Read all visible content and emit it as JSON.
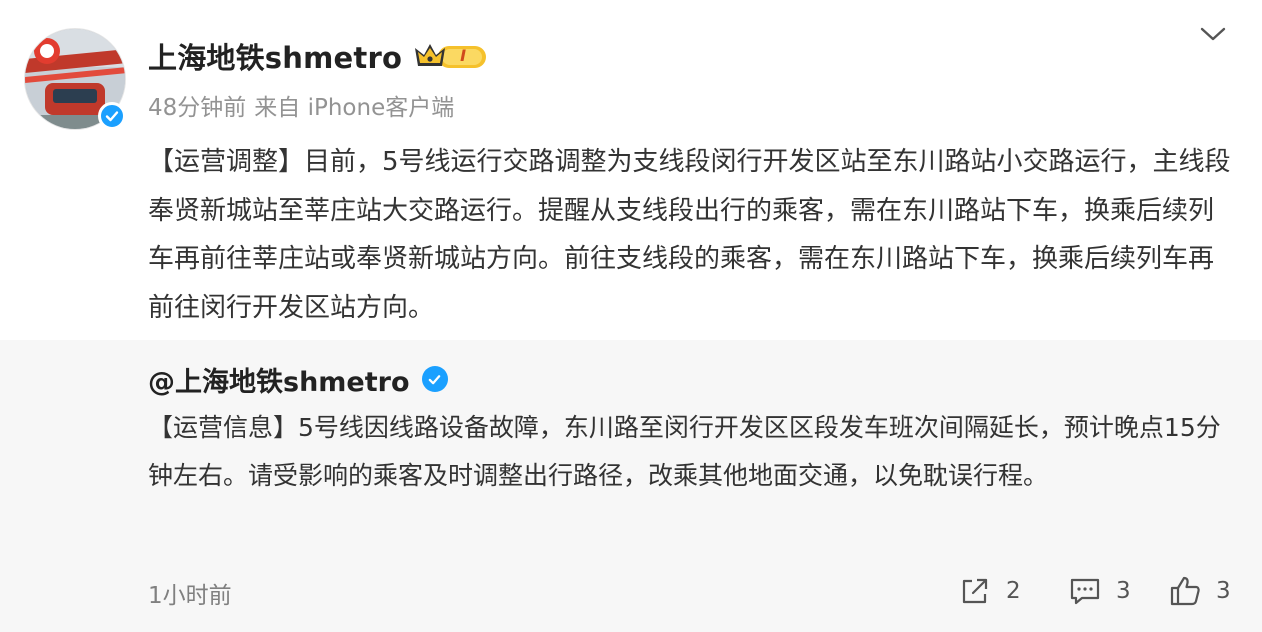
{
  "post": {
    "author_name": "上海地铁shmetro",
    "vip_level": "I",
    "time_ago": "48分钟前",
    "source": "来自 iPhone客户端",
    "content": "【运营调整】目前，5号线运行交路调整为支线段闵行开发区站至东川路站小交路运行，主线段奉贤新城站至莘庄站大交路运行。提醒从支线段出行的乘客，需在东川路站下车，换乘后续列车再前往莘庄站或奉贤新城站方向。前往支线段的乘客，需在东川路站下车，换乘后续列车再前往闵行开发区站方向。"
  },
  "repost": {
    "author_handle": "@上海地铁shmetro",
    "content": "【运营信息】5号线因线路设备故障，东川路至闵行开发区区段发车班次间隔延长，预计晚点15分钟左右。请受影响的乘客及时调整出行路径，改乘其他地面交通，以免耽误行程。",
    "time_ago": "1小时前",
    "share_count": "2",
    "comment_count": "3",
    "like_count": "3"
  },
  "icons": {
    "more": "chevron-down-icon",
    "verified": "verified-check-icon",
    "vip": "crown-icon",
    "share": "share-icon",
    "comment": "comment-icon",
    "like": "thumbs-up-icon"
  },
  "colors": {
    "verified_blue": "#1ba0ff",
    "vip_gold": "#f5c12c",
    "repost_background": "#f7f7f7"
  }
}
